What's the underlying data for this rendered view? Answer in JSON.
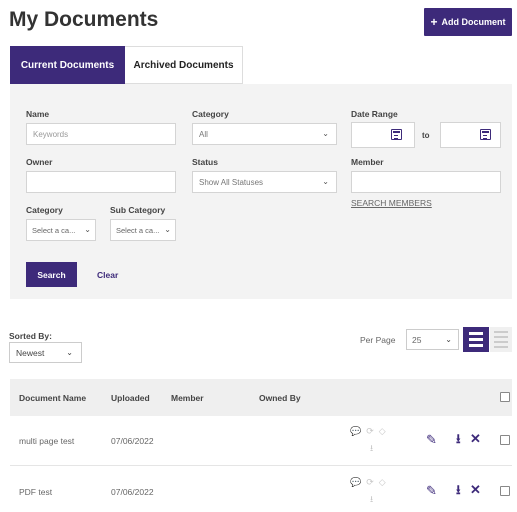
{
  "page": {
    "title": "My Documents",
    "add_button": "Add Document",
    "add_icon": "+"
  },
  "tabs": [
    {
      "label": "Current Documents",
      "active": true
    },
    {
      "label": "Archived Documents",
      "active": false
    }
  ],
  "filters": {
    "name": {
      "label": "Name",
      "placeholder": "Keywords",
      "value": ""
    },
    "category": {
      "label": "Category",
      "value": "All"
    },
    "date_range": {
      "label": "Date Range",
      "to_label": "to"
    },
    "owner": {
      "label": "Owner",
      "value": ""
    },
    "status": {
      "label": "Status",
      "value": "Show All Statuses"
    },
    "member": {
      "label": "Member",
      "value": "",
      "search_link": "SEARCH MEMBERS"
    },
    "category2": {
      "label": "Category",
      "value": "Select a ca..."
    },
    "sub_category": {
      "label": "Sub Category",
      "value": "Select a ca..."
    },
    "search_button": "Search",
    "clear_link": "Clear"
  },
  "sorting": {
    "label": "Sorted By:",
    "value": "Newest"
  },
  "per_page": {
    "label": "Per Page",
    "value": "25"
  },
  "table": {
    "headers": [
      "Document Name",
      "Uploaded",
      "Member",
      "Owned By"
    ],
    "rows": [
      {
        "name": "multi page test",
        "uploaded": "07/06/2022",
        "member": "",
        "owned_by": ""
      },
      {
        "name": "PDF test",
        "uploaded": "07/06/2022",
        "member": "",
        "owned_by": ""
      }
    ]
  },
  "icons": {
    "chevron": "⌄",
    "comment": "💬",
    "sync": "⟳",
    "tag": "◇",
    "download_muted": "⭳",
    "edit": "✎",
    "download": "⭳",
    "delete": "✕"
  },
  "colors": {
    "accent": "#3d2a7a",
    "panel": "#f3f3f3"
  }
}
